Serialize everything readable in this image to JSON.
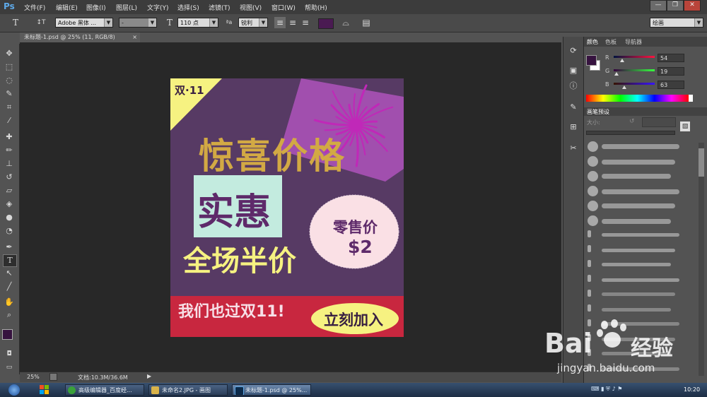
{
  "app": {
    "logo": "Ps"
  },
  "menu": [
    "文件(F)",
    "编辑(E)",
    "图像(I)",
    "图层(L)",
    "文字(Y)",
    "选择(S)",
    "滤镜(T)",
    "视图(V)",
    "窗口(W)",
    "帮助(H)"
  ],
  "window_controls": [
    "—",
    "❐",
    "✕"
  ],
  "options": {
    "font_family": "Adobe 黑体 ...",
    "font_style": "-",
    "font_size": "110 点",
    "aa_label": "ªa",
    "anti_alias": "锐利",
    "workspace": "绘画",
    "text_color": "#4a1a52"
  },
  "document": {
    "tab_title": "未标题-1.psd @ 25% (11, RGB/8)"
  },
  "poster": {
    "corner_text": "双·11",
    "headline": "惊喜价格",
    "box_text": "实惠",
    "halfprice": "全场半价",
    "price_label": "零售价",
    "price_value": "$2",
    "banner_text": "我们也过双11!",
    "join_text": "立刻加入",
    "colors": {
      "bg": "#573a64",
      "gold": "#d2a944",
      "mint": "#c3ebdf",
      "pink": "#fae0e5",
      "red": "#c8273f",
      "yellow": "#f6f281",
      "purple_text": "#5e2a6a",
      "burst": "#a14fae"
    }
  },
  "panels": {
    "color_tabs": [
      "颜色",
      "色板",
      "导航器"
    ],
    "rgb": [
      {
        "channel": "R",
        "value": "54",
        "pos": 0.21
      },
      {
        "channel": "G",
        "value": "19",
        "pos": 0.07
      },
      {
        "channel": "B",
        "value": "63",
        "pos": 0.25
      }
    ],
    "foreground": "#36133f",
    "brush_tab": "画笔预设",
    "size_label": "大小:"
  },
  "status": {
    "zoom": "25%",
    "doc_info": "文档:10.3M/36.6M"
  },
  "taskbar": {
    "items": [
      "高级编辑器_百度经...",
      "未命名2.JPG - 画图",
      "未标题-1.psd @ 25%..."
    ],
    "clock": "10:20"
  },
  "watermark": {
    "brand": "Bai",
    "brand2": "经验",
    "url": "jingyan.baidu.com"
  }
}
